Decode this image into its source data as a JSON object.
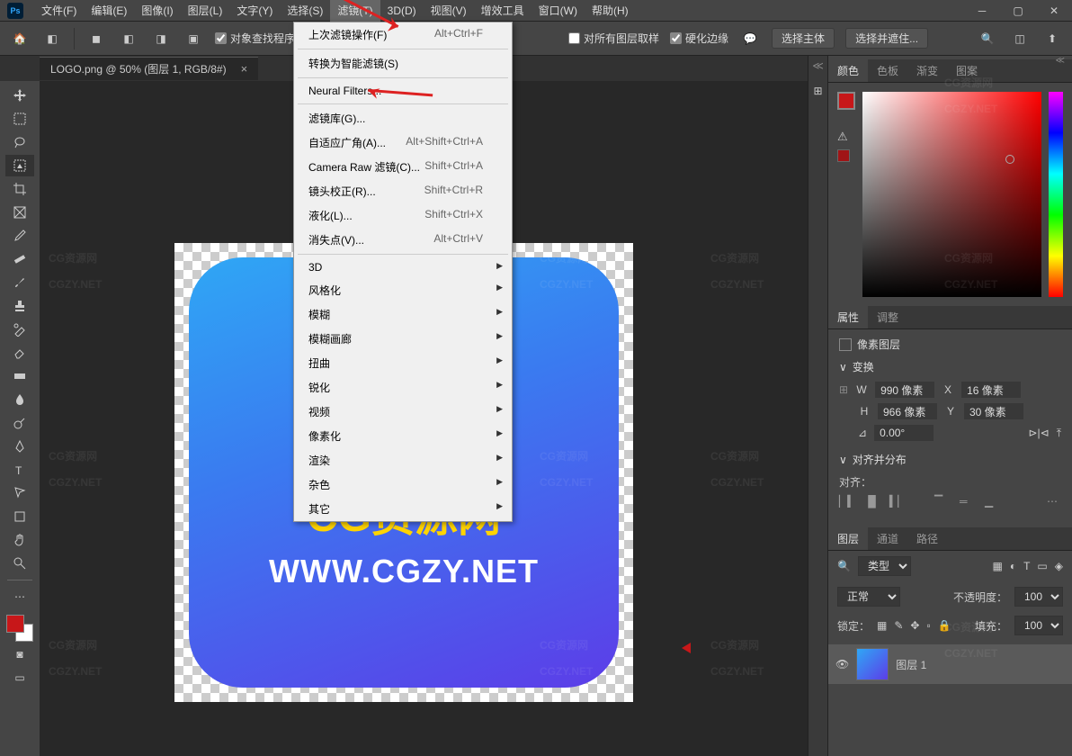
{
  "menubar": {
    "items": [
      "文件(F)",
      "编辑(E)",
      "图像(I)",
      "图层(L)",
      "文字(Y)",
      "选择(S)",
      "滤镜(T)",
      "3D(D)",
      "视图(V)",
      "增效工具",
      "窗口(W)",
      "帮助(H)"
    ]
  },
  "optionsbar": {
    "check1": "对象查找程序",
    "check2": "对所有图层取样",
    "check3": "硬化边缘",
    "btn1": "选择主体",
    "btn2": "选择并遮住..."
  },
  "doctab": {
    "title": "LOGO.png @ 50% (图层 1, RGB/8#)"
  },
  "dropdown": {
    "items": [
      {
        "label": "上次滤镜操作(F)",
        "shortcut": "Alt+Ctrl+F"
      },
      {
        "sep": true
      },
      {
        "label": "转换为智能滤镜(S)"
      },
      {
        "sep": true
      },
      {
        "label": "Neural Filters..."
      },
      {
        "sep": true
      },
      {
        "label": "滤镜库(G)..."
      },
      {
        "label": "自适应广角(A)...",
        "shortcut": "Alt+Shift+Ctrl+A"
      },
      {
        "label": "Camera Raw 滤镜(C)...",
        "shortcut": "Shift+Ctrl+A"
      },
      {
        "label": "镜头校正(R)...",
        "shortcut": "Shift+Ctrl+R"
      },
      {
        "label": "液化(L)...",
        "shortcut": "Shift+Ctrl+X"
      },
      {
        "label": "消失点(V)...",
        "shortcut": "Alt+Ctrl+V"
      },
      {
        "sep": true
      },
      {
        "label": "3D",
        "sub": true
      },
      {
        "label": "风格化",
        "sub": true
      },
      {
        "label": "模糊",
        "sub": true
      },
      {
        "label": "模糊画廊",
        "sub": true
      },
      {
        "label": "扭曲",
        "sub": true
      },
      {
        "label": "锐化",
        "sub": true
      },
      {
        "label": "视频",
        "sub": true
      },
      {
        "label": "像素化",
        "sub": true
      },
      {
        "label": "渲染",
        "sub": true
      },
      {
        "label": "杂色",
        "sub": true
      },
      {
        "label": "其它",
        "sub": true
      }
    ]
  },
  "logo": {
    "text1": "CG资源网",
    "text2": "WWW.CGZY.NET"
  },
  "panels": {
    "color_tabs": [
      "颜色",
      "色板",
      "渐变",
      "图案"
    ],
    "prop_tabs": [
      "属性",
      "调整"
    ],
    "prop_title": "像素图层",
    "transform_title": "变换",
    "w_val": "990 像素",
    "x_label": "X",
    "x_val": "16 像素",
    "h_val": "966 像素",
    "y_label": "Y",
    "y_val": "30 像素",
    "angle": "0.00°",
    "align_title": "对齐并分布",
    "align_label": "对齐：",
    "layer_tabs": [
      "图层",
      "通道",
      "路径"
    ],
    "blend_mode": "正常",
    "opacity_label": "不透明度：",
    "opacity": "100%",
    "lock_label": "锁定：",
    "fill_label": "填充：",
    "fill": "100%",
    "layer_name": "图层 1",
    "kind_label": "类型"
  },
  "watermark": {
    "line1": "CG资源网",
    "line2": "CGZY.NET"
  }
}
